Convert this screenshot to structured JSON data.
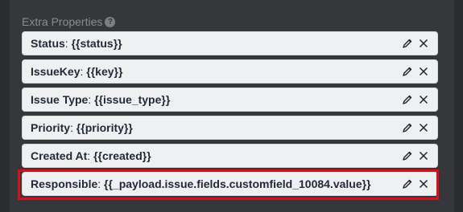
{
  "section": {
    "title": "Extra Properties",
    "help_icon": "question-circle-icon"
  },
  "properties": [
    {
      "key": "Status",
      "value": "{{status}}"
    },
    {
      "key": "IssueKey",
      "value": "{{key}}"
    },
    {
      "key": "Issue Type",
      "value": "{{issue_type}}"
    },
    {
      "key": "Priority",
      "value": "{{priority}}"
    },
    {
      "key": "Created At",
      "value": "{{created}}"
    },
    {
      "key": "Responsible",
      "value": "{{_payload.issue.fields.customfield_10084.value}}"
    }
  ],
  "icons": {
    "edit": "pencil-icon",
    "remove": "close-icon"
  },
  "colors": {
    "highlight": "#d90f19",
    "background": "#2a2c2f",
    "row": "#eef0f2"
  }
}
